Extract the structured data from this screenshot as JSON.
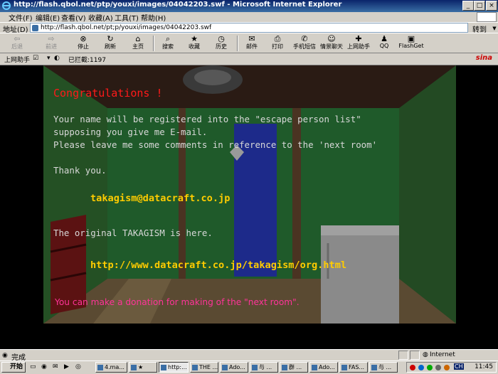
{
  "window": {
    "title": "http://flash.qbol.net/ptp/youxi/images/04042203.swf - Microsoft Internet Explorer",
    "controls": {
      "minimize": "_",
      "maximize": "□",
      "close": "×"
    }
  },
  "menu": [
    "文件(F)",
    "编辑(E)",
    "查看(V)",
    "收藏(A)",
    "工具(T)",
    "帮助(H)"
  ],
  "address": {
    "label": "地址(D)",
    "url": "http://flash.qbol.net/pt;p/youxi/images/04042203.swf",
    "go": "转到"
  },
  "toolbar": [
    {
      "label": "后退",
      "icon": "back-arrow-icon",
      "glyph": "⇦",
      "disabled": true
    },
    {
      "label": "前进",
      "icon": "forward-arrow-icon",
      "glyph": "⇨",
      "disabled": true
    },
    {
      "label": "停止",
      "icon": "stop-icon",
      "glyph": "⊗",
      "disabled": false
    },
    {
      "label": "刷新",
      "icon": "refresh-icon",
      "glyph": "↻",
      "disabled": false
    },
    {
      "label": "主页",
      "icon": "home-icon",
      "glyph": "⌂",
      "disabled": false
    },
    {
      "label": "搜索",
      "icon": "search-icon",
      "glyph": "⌕",
      "disabled": false
    },
    {
      "label": "收藏",
      "icon": "favorites-icon",
      "glyph": "★",
      "disabled": false
    },
    {
      "label": "历史",
      "icon": "history-icon",
      "glyph": "◷",
      "disabled": false
    },
    {
      "label": "邮件",
      "icon": "mail-icon",
      "glyph": "✉",
      "disabled": false
    },
    {
      "label": "打印",
      "icon": "print-icon",
      "glyph": "⎙",
      "disabled": false
    },
    {
      "label": "手机短信",
      "icon": "sms-icon",
      "glyph": "✆",
      "disabled": false
    },
    {
      "label": "情景聊天",
      "icon": "chat-icon",
      "glyph": "☺",
      "disabled": false
    },
    {
      "label": "上网助手",
      "icon": "assistant-icon",
      "glyph": "✚",
      "disabled": false
    },
    {
      "label": "QQ",
      "icon": "qq-penguin-icon",
      "glyph": "♟",
      "disabled": false
    },
    {
      "label": "FlashGet",
      "icon": "flashget-icon",
      "glyph": "▣",
      "disabled": false
    }
  ],
  "links_bar": {
    "assistant": "上网助手",
    "blocked": "已拦截:1197",
    "logo": "sina"
  },
  "flash": {
    "congrats": "Congratulations !",
    "body": "Your name will be registered into the \"escape person list\"\nsupposing you give me E-mail.\nPlease leave me some comments in reference to the 'next room'",
    "thanks": "Thank you.",
    "email": "takagism@datacraft.co.jp",
    "original": "The original TAKAGISM is here.",
    "url": "http://www.datacraft.co.jp/takagism/org.html",
    "donation": "You can make a donation for making of the \"next room\".",
    "colors": {
      "congrats": "#ff1a1a",
      "body": "#d8d8d8",
      "link": "#ffcc00",
      "donation": "#ff3399"
    }
  },
  "status": {
    "text": "完成",
    "zone": "Internet"
  },
  "taskbar": {
    "start": "开始",
    "tasks": [
      {
        "label": "4.ma...",
        "active": false
      },
      {
        "label": "★",
        "active": false
      },
      {
        "label": "http:...",
        "active": true
      },
      {
        "label": "THE ...",
        "active": false
      },
      {
        "label": "Ado...",
        "active": false
      },
      {
        "label": "与 ...",
        "active": false
      },
      {
        "label": "群 ...",
        "active": false
      },
      {
        "label": "Ado...",
        "active": false
      },
      {
        "label": "FAS...",
        "active": false
      },
      {
        "label": "与 ...",
        "active": false
      }
    ],
    "tray_lang": "CH",
    "clock": "11:45"
  }
}
